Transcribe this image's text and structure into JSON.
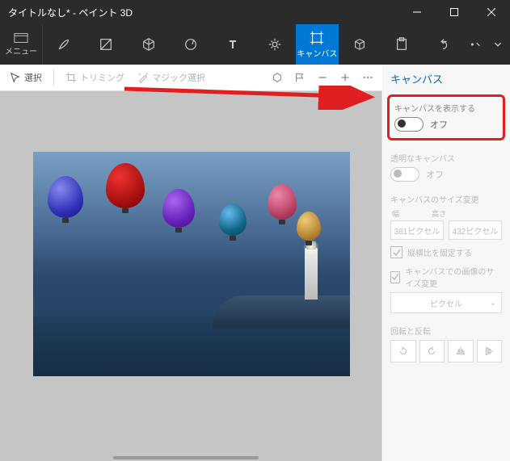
{
  "window": {
    "title": "タイトルなし* - ペイント 3D"
  },
  "menu": {
    "label": "メニュー"
  },
  "tabs": {
    "canvas": "キャンバス"
  },
  "toolbar": {
    "select": "選択",
    "trimming": "トリミング",
    "magic": "マジック選択"
  },
  "panel": {
    "title": "キャンバス",
    "show": {
      "label": "キャンバスを表示する",
      "state": "オフ"
    },
    "transparent": {
      "label": "透明なキャンバス",
      "state": "オフ"
    },
    "resize": {
      "label": "キャンバスのサイズ変更",
      "w_label": "幅",
      "h_label": "高さ",
      "w": "381ピクセル",
      "h": "432ピクセル"
    },
    "lockRatio": "縦横比を固定する",
    "resizeImage": "キャンバスでの画像のサイズ変更",
    "unit": "ピクセル",
    "rotate": "回転と反転"
  }
}
